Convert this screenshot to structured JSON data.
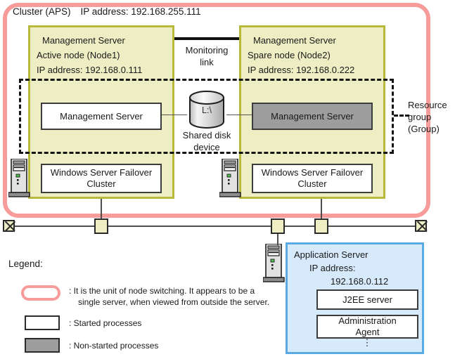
{
  "cluster": {
    "title_primary": "Cluster (APS)",
    "title_ip": "IP address: 192.168.255.111"
  },
  "nodes": {
    "active": {
      "role_label": "Management Server",
      "node_label": "Active node (Node1)",
      "ip_label": "IP address: 192.168.0.111",
      "process_started": "Management Server",
      "process_cluster": "Windows Server Failover Cluster"
    },
    "spare": {
      "role_label": "Management Server",
      "node_label": "Spare node (Node2)",
      "ip_label": "IP address: 192.168.0.222",
      "process_nonstarted": "Management Server",
      "process_cluster": "Windows Server Failover Cluster"
    }
  },
  "monitoring_link": {
    "label_line1": "Monitoring",
    "label_line2": "link"
  },
  "shared_disk": {
    "drive_label": "L:\\",
    "caption_line1": "Shared disk",
    "caption_line2": "device"
  },
  "resource_group": {
    "label_line1": "Resource",
    "label_line2": "group",
    "label_line3": "(Group)"
  },
  "app_server": {
    "title": "Application Server",
    "ip_label": "IP address:",
    "ip_value": "192.168.0.112",
    "component_j2ee": "J2EE server",
    "component_admin_line1": "Administration",
    "component_admin_line2": "Agent",
    "ellipsis": "⋮"
  },
  "legend": {
    "title": "Legend:",
    "cluster_line1": ": It is the unit of node switching. It appears to be a",
    "cluster_line2": "single server, when viewed from outside the server.",
    "started": ": Started processes",
    "nonstarted": ": Non-started processes"
  },
  "colors": {
    "cluster_band": "#f79b9b",
    "node_fill": "#eeeec4",
    "node_border": "#b8b83c",
    "nonstarted_fill": "#9d9d9d",
    "app_panel_fill": "#d6eafc",
    "app_panel_border": "#5aaae4",
    "line": "#4d4d4d"
  },
  "icons": {
    "tower_server": "tower-server-icon",
    "shared_disk": "database-cylinder-icon",
    "network_terminator": "network-terminator-icon",
    "network_tap": "network-tap-icon"
  }
}
